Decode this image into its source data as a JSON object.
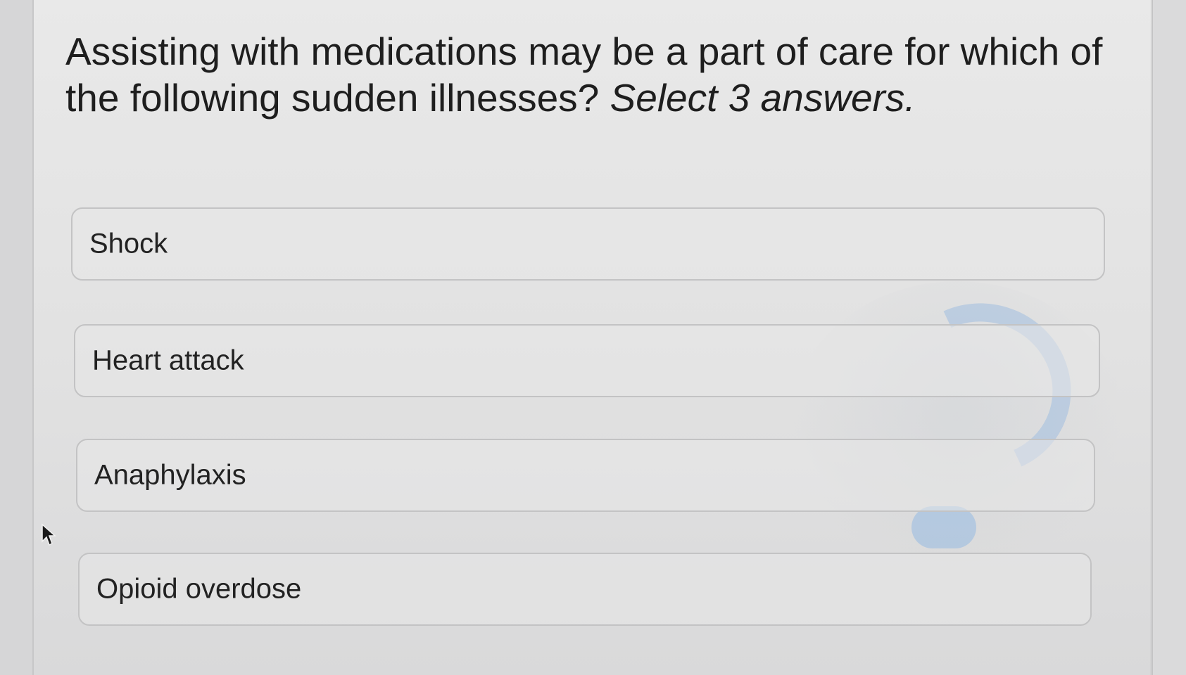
{
  "question": {
    "text": "Assisting with medications may be a part of care for which of the following sudden illnesses?",
    "instruction": "Select 3 answers."
  },
  "options": [
    {
      "label": "Shock"
    },
    {
      "label": "Heart attack"
    },
    {
      "label": "Anaphylaxis"
    },
    {
      "label": "Opioid overdose"
    }
  ],
  "icons": {
    "pointer": "mouse-pointer-icon"
  }
}
